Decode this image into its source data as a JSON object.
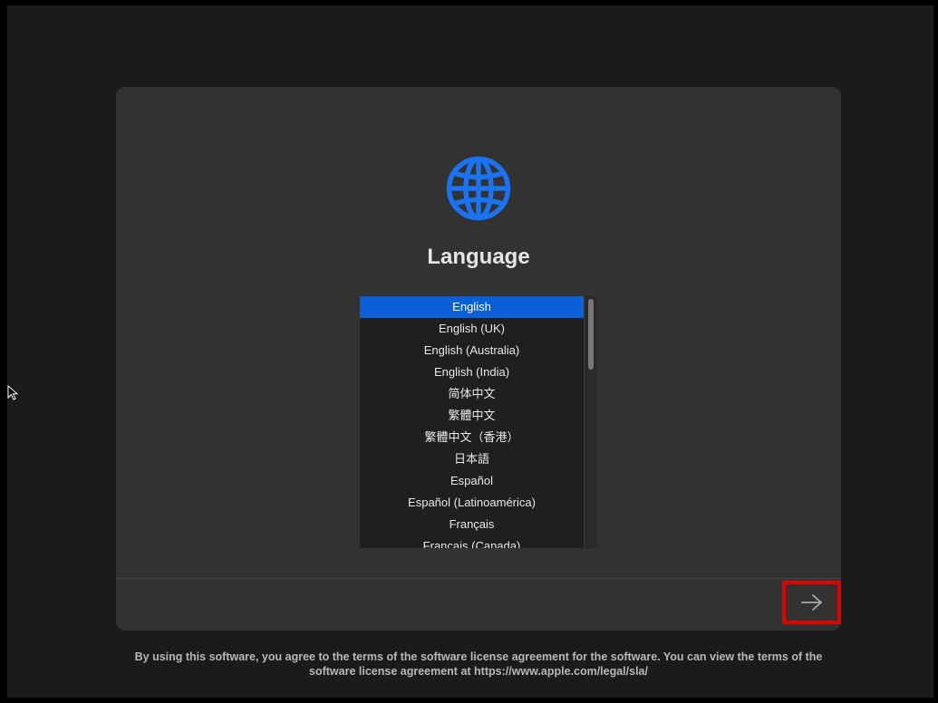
{
  "title": "Language",
  "languages": [
    "English",
    "English (UK)",
    "English (Australia)",
    "English (India)",
    "简体中文",
    "繁體中文",
    "繁體中文（香港）",
    "日本語",
    "Español",
    "Español (Latinoamérica)",
    "Français",
    "Français (Canada)"
  ],
  "selected_language": "English",
  "license_text": "By using this software, you agree to the terms of the software license agreement for the software. You can view the terms of the software license agreement at https://www.apple.com/legal/sla/",
  "icons": {
    "globe": "globe-icon",
    "next": "arrow-right-icon",
    "cursor": "mouse-pointer-icon"
  },
  "colors": {
    "accent": "#0a60d6",
    "globe": "#1a73f0",
    "highlight_border": "#e10000"
  }
}
